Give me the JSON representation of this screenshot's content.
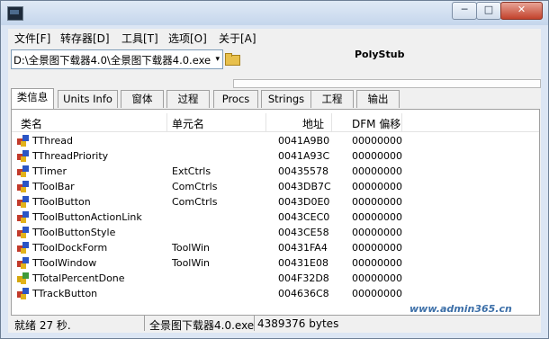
{
  "window": {
    "minimize_glyph": "─",
    "maximize_glyph": "□",
    "close_glyph": "✕"
  },
  "menu": [
    "文件[F]",
    "转存器[D]",
    "工具[T]",
    "选项[O]",
    "关于[A]"
  ],
  "path": {
    "value": "D:\\全景图下载器4.0\\全景图下载器4.0.exe",
    "arrow": "▾"
  },
  "program_title": "PolyStub",
  "tabs": [
    "类信息",
    "Units Info",
    "窗体",
    "过程",
    "Procs",
    "Strings",
    "工程",
    "输出"
  ],
  "columns": [
    "类名",
    "单元名",
    "地址",
    "DFM 偏移"
  ],
  "rows": [
    {
      "name": "TThread",
      "unit": "",
      "addr": "0041A9B0",
      "dfm": "00000000",
      "icon": "class-icon"
    },
    {
      "name": "TThreadPriority",
      "unit": "",
      "addr": "0041A93C",
      "dfm": "00000000",
      "icon": "class-icon"
    },
    {
      "name": "TTimer",
      "unit": "ExtCtrls",
      "addr": "00435578",
      "dfm": "00000000",
      "icon": "class-icon"
    },
    {
      "name": "TToolBar",
      "unit": "ComCtrls",
      "addr": "0043DB7C",
      "dfm": "00000000",
      "icon": "class-icon"
    },
    {
      "name": "TToolButton",
      "unit": "ComCtrls",
      "addr": "0043D0E0",
      "dfm": "00000000",
      "icon": "class-icon"
    },
    {
      "name": "TToolButtonActionLink",
      "unit": "",
      "addr": "0043CEC0",
      "dfm": "00000000",
      "icon": "class-icon"
    },
    {
      "name": "TToolButtonStyle",
      "unit": "",
      "addr": "0043CE58",
      "dfm": "00000000",
      "icon": "class-icon"
    },
    {
      "name": "TToolDockForm",
      "unit": "ToolWin",
      "addr": "00431FA4",
      "dfm": "00000000",
      "icon": "class-icon"
    },
    {
      "name": "TToolWindow",
      "unit": "ToolWin",
      "addr": "00431E08",
      "dfm": "00000000",
      "icon": "class-icon"
    },
    {
      "name": "TTotalPercentDone",
      "unit": "",
      "addr": "004F32D8",
      "dfm": "00000000",
      "icon": "type-icon"
    },
    {
      "name": "TTrackButton",
      "unit": "",
      "addr": "004636C8",
      "dfm": "00000000",
      "icon": "class-icon"
    }
  ],
  "status": {
    "time": "就绪 27 秒.",
    "file": "全景图下载器4.0.exe",
    "size": "4389376 bytes"
  },
  "watermark": "www.admin365.cn"
}
